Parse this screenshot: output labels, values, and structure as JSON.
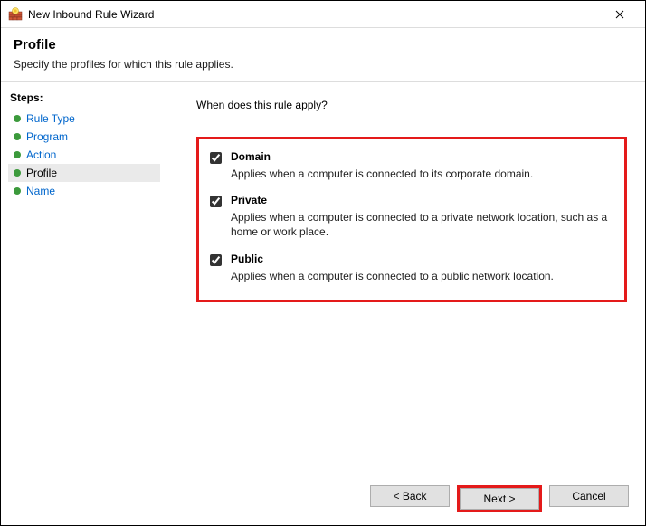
{
  "window": {
    "title": "New Inbound Rule Wizard"
  },
  "header": {
    "title": "Profile",
    "subtitle": "Specify the profiles for which this rule applies."
  },
  "sidebar": {
    "title": "Steps:",
    "items": [
      {
        "label": "Rule Type"
      },
      {
        "label": "Program"
      },
      {
        "label": "Action"
      },
      {
        "label": "Profile"
      },
      {
        "label": "Name"
      }
    ],
    "activeIndex": 3
  },
  "main": {
    "prompt": "When does this rule apply?",
    "options": [
      {
        "label": "Domain",
        "desc": "Applies when a computer is connected to its corporate domain.",
        "checked": true
      },
      {
        "label": "Private",
        "desc": "Applies when a computer is connected to a private network location, such as a home or work place.",
        "checked": true
      },
      {
        "label": "Public",
        "desc": "Applies when a computer is connected to a public network location.",
        "checked": true
      }
    ]
  },
  "footer": {
    "back": "< Back",
    "next": "Next >",
    "cancel": "Cancel"
  }
}
